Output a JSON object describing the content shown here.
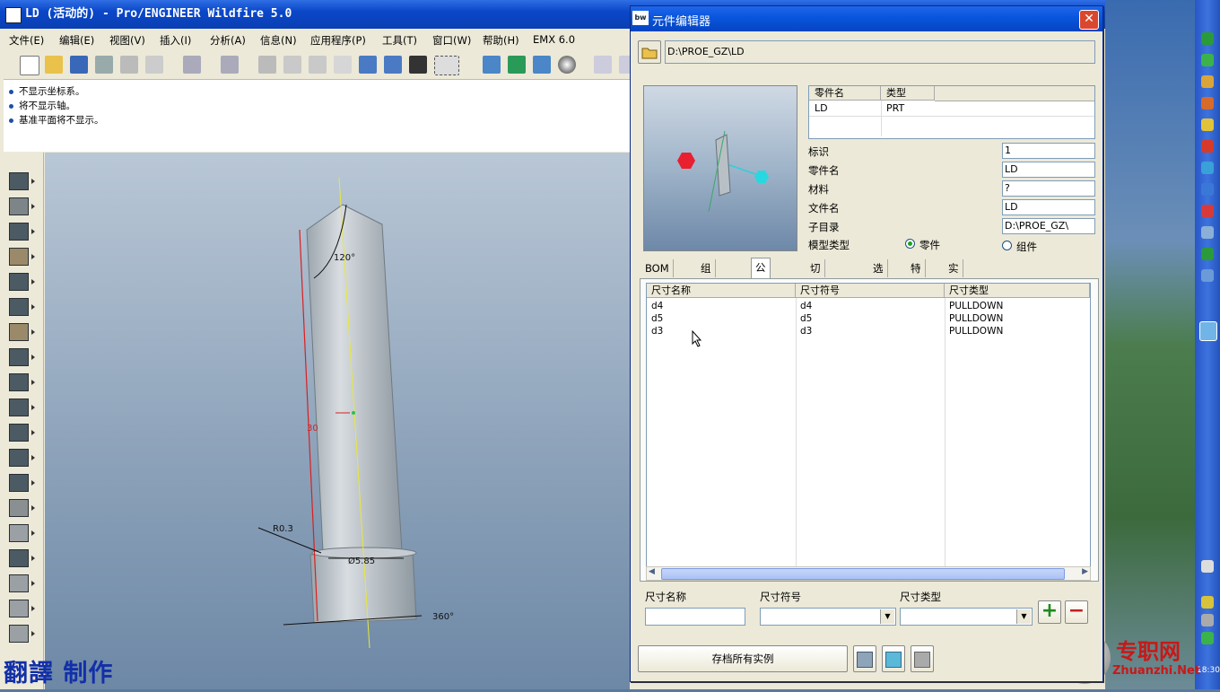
{
  "main_window": {
    "title": "LD (活动的) - Pro/ENGINEER Wildfire 5.0",
    "menu": [
      "文件(E)",
      "编辑(E)",
      "视图(V)",
      "插入(I)",
      "分析(A)",
      "信息(N)",
      "应用程序(P)",
      "工具(T)",
      "窗口(W)",
      "帮助(H)",
      "EMX 6.0"
    ],
    "messages": [
      "不显示坐标系。",
      "将不显示轴。",
      "基准平面将不显示。"
    ]
  },
  "model": {
    "dims": {
      "angle": "120°",
      "length": "30",
      "radius": "R0.3",
      "diameter": "Ø5.85",
      "rotation": "360°"
    }
  },
  "watermark": "翻譯   制作",
  "dialog": {
    "title": "元件编辑器",
    "path": "D:\\PROE_GZ\\LD",
    "parts_table": {
      "headers": [
        "零件名",
        "类型"
      ],
      "rows": [
        [
          "LD",
          "PRT"
        ]
      ]
    },
    "props": [
      {
        "label": "标识",
        "value": "1"
      },
      {
        "label": "零件名",
        "value": "LD"
      },
      {
        "label": "材料",
        "value": "?"
      },
      {
        "label": "文件名",
        "value": "LD"
      },
      {
        "label": "子目录",
        "value": "D:\\PROE_GZ\\"
      }
    ],
    "model_type": {
      "label": "模型类型",
      "option_part": "零件",
      "option_asm": "组件",
      "selected": "零件"
    },
    "tabs": [
      "BOM 数据",
      "组件参照",
      "公称尺寸",
      "切口和螺纹",
      "选项",
      "特征",
      "实例"
    ],
    "active_tab": "公称尺寸",
    "grid": {
      "headers": [
        "尺寸名称",
        "尺寸符号",
        "尺寸类型"
      ],
      "rows": [
        [
          "d4",
          "d4",
          "PULLDOWN"
        ],
        [
          "d5",
          "d5",
          "PULLDOWN"
        ],
        [
          "d3",
          "d3",
          "PULLDOWN"
        ]
      ]
    },
    "entry": {
      "name_label": "尺寸名称",
      "symbol_label": "尺寸符号",
      "type_label": "尺寸类型",
      "name": "",
      "symbol": "",
      "type": ""
    },
    "save_all_label": "存档所有实例"
  },
  "site_logo": {
    "cn": "专职网",
    "en": "Zhuanzhi.Net"
  },
  "clock": "18:30",
  "colors": {
    "title_blue": "#0a47c8",
    "dim_red": "#d82020",
    "add_green": "#1e8a1e",
    "remove_red": "#c42020"
  }
}
